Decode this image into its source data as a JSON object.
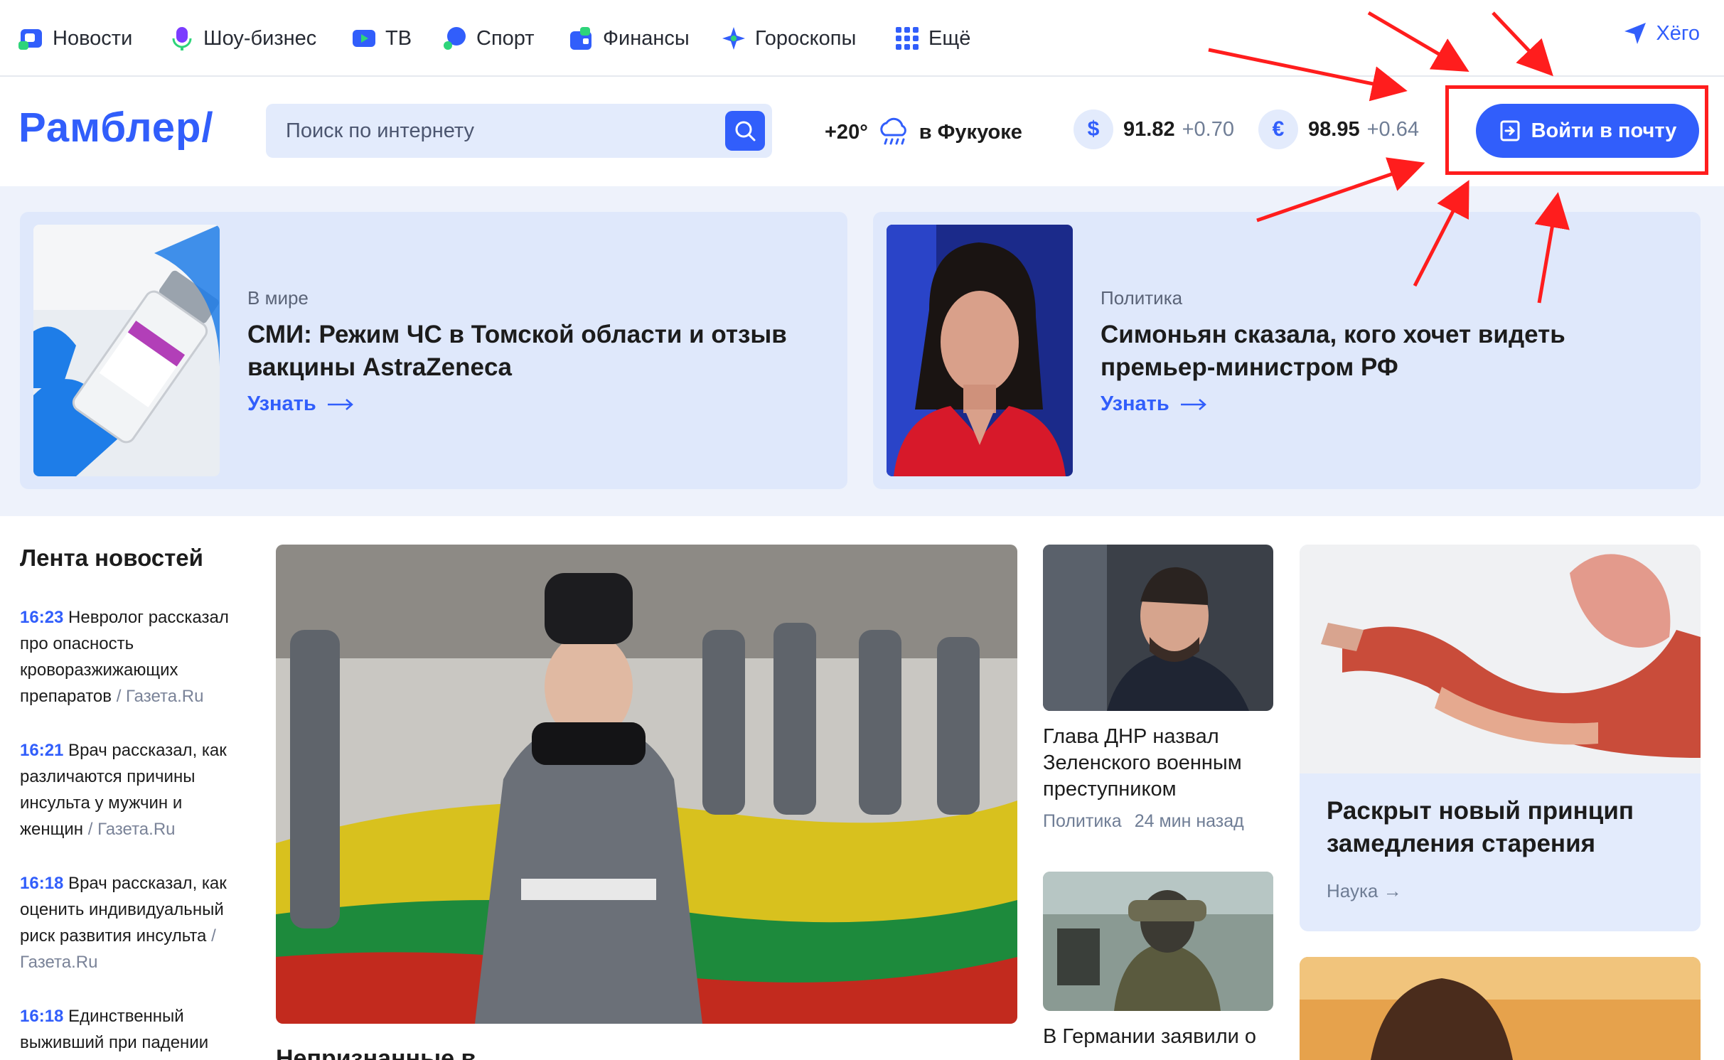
{
  "topnav": {
    "items": [
      {
        "label": "Новости",
        "icon": "news-icon",
        "color": "#315efb"
      },
      {
        "label": "Шоу-бизнес",
        "icon": "microphone-icon",
        "color": "#7b3cff"
      },
      {
        "label": "ТВ",
        "icon": "tv-icon",
        "color": "#315efb"
      },
      {
        "label": "Спорт",
        "icon": "sport-icon",
        "color": "#315efb"
      },
      {
        "label": "Финансы",
        "icon": "finance-icon",
        "color": "#315efb"
      },
      {
        "label": "Гороскопы",
        "icon": "star-icon",
        "color": "#315efb"
      },
      {
        "label": "Ещё",
        "icon": "grid-icon",
        "color": "#315efb"
      }
    ],
    "user": "Хёго"
  },
  "header": {
    "logo": "Рамблер/",
    "search_placeholder": "Поиск по интернету",
    "weather": {
      "temp": "+20°",
      "city": "в Фукуоке"
    },
    "usd": {
      "symbol": "$",
      "value": "91.82",
      "delta": "+0.70"
    },
    "eur": {
      "symbol": "€",
      "value": "98.95",
      "delta": "+0.64"
    },
    "login_label": "Войти в почту"
  },
  "hero": [
    {
      "category": "В мире",
      "title": "СМИ: Режим ЧС в Томской области и отзыв вакцины AstraZeneca",
      "more": "Узнать"
    },
    {
      "category": "Политика",
      "title": "Симоньян сказала, кого хочет видеть премьер-министром РФ",
      "more": "Узнать"
    }
  ],
  "feed": {
    "title": "Лента новостей",
    "items": [
      {
        "time": "16:23",
        "text": " Невролог рассказал про опасность кроворазжижающих препаратов",
        "source": " / Газета.Ru"
      },
      {
        "time": "16:21",
        "text": " Врач рассказал, как различаются причины инсульта у мужчин и женщин",
        "source": " / Газета.Ru"
      },
      {
        "time": "16:18",
        "text": " Врач рассказал, как оценить индивидуальный риск развития инсульта",
        "source": " / Газета.Ru"
      },
      {
        "time": "16:18",
        "text": " Единственный выживший при падении",
        "source": ""
      }
    ]
  },
  "main_caption": "Непризнанные в...",
  "side": [
    {
      "title": "Глава ДНР назвал Зеленского военным преступником",
      "category": "Политика",
      "time": "24 мин назад"
    },
    {
      "title": "В Германии заявили о",
      "category": "",
      "time": ""
    }
  ],
  "big_card": {
    "title": "Раскрыт новый принцип замедления старения",
    "category": "Наука →"
  },
  "colors": {
    "accent": "#315efb",
    "highlight": "#ff1d1d",
    "band": "#eef2fb"
  }
}
